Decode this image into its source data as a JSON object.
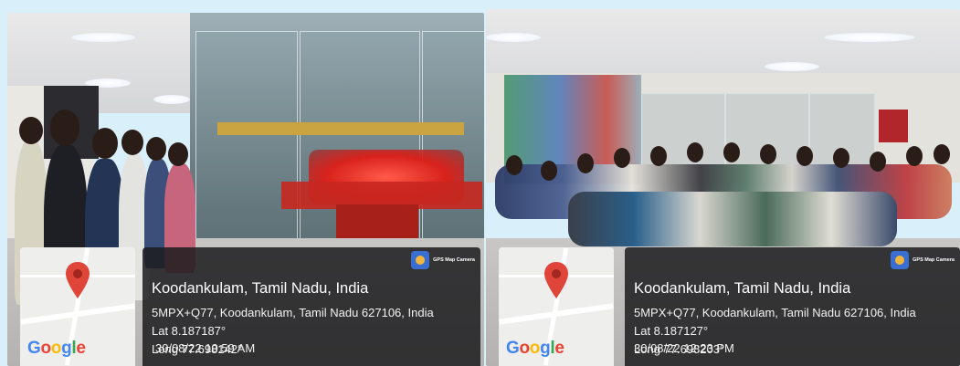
{
  "photos": [
    {
      "id": "left",
      "place": "Koodankulam, Tamil Nadu, India",
      "address": "5MPX+Q77, Koodankulam, Tamil Nadu 627106, India",
      "lat": "Lat 8.187187°",
      "long": "Long 77.698142°",
      "datetime": "30/08/22 10:59 AM",
      "badge": "GPS Map Camera",
      "map_logo": "Google"
    },
    {
      "id": "right",
      "place": "Koodankulam, Tamil Nadu, India",
      "address": "5MPX+Q77, Koodankulam, Tamil Nadu 627106, India",
      "lat": "Lat 8.187127°",
      "long": "Long 77.698203°",
      "datetime": "30/08/22 12:23 PM",
      "badge": "GPS Map Camera",
      "map_logo": "Google"
    }
  ],
  "colors": {
    "page_background": "#d9f0fb",
    "overlay": "#1c1c1e",
    "pin": "#e0453a",
    "accent_red_model": "#e8322b"
  }
}
